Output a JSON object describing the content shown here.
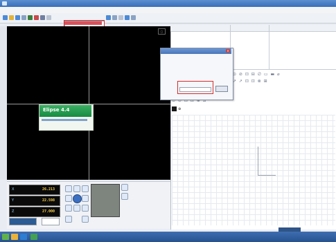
{
  "window": {
    "title": ""
  },
  "menu": {
    "items": [
      "",
      "",
      "",
      "",
      "",
      ""
    ]
  },
  "dropdown": {
    "selected": "",
    "secondary": ""
  },
  "splash": {
    "title": "Elipse 4.4",
    "subtitle": ""
  },
  "dro": {
    "x": {
      "axis": "X",
      "value": "26.213"
    },
    "y": {
      "axis": "Y",
      "value": "22.598"
    },
    "z": {
      "axis": "Z",
      "value": "27.000"
    }
  },
  "right_panel": {
    "columns": [
      "",
      "",
      "",
      "",
      "",
      ""
    ],
    "tool_rows": [
      "⊙ ⊘ ⊡ ⊟ ∅ ▭ ▬ ⌀",
      "↗ ↗ ⊡ ⊡ ⊗ ⊞",
      "◇ ◇ ▭ ▬ ◡ ⊿ ⌒",
      "⊙ ⊙ ⊡ ⊡ ⊕ ⊿"
    ],
    "corner_label": ""
  },
  "dialog": {
    "title": "",
    "lines": [
      "",
      "",
      "",
      "",
      "",
      ""
    ],
    "button": ""
  },
  "status": {
    "ok_button": ""
  },
  "colors": {
    "accent": "#3a6db8",
    "splash_green": "#168a40",
    "dro_yellow": "#ffd44a",
    "highlight_red": "#d62a2a"
  }
}
